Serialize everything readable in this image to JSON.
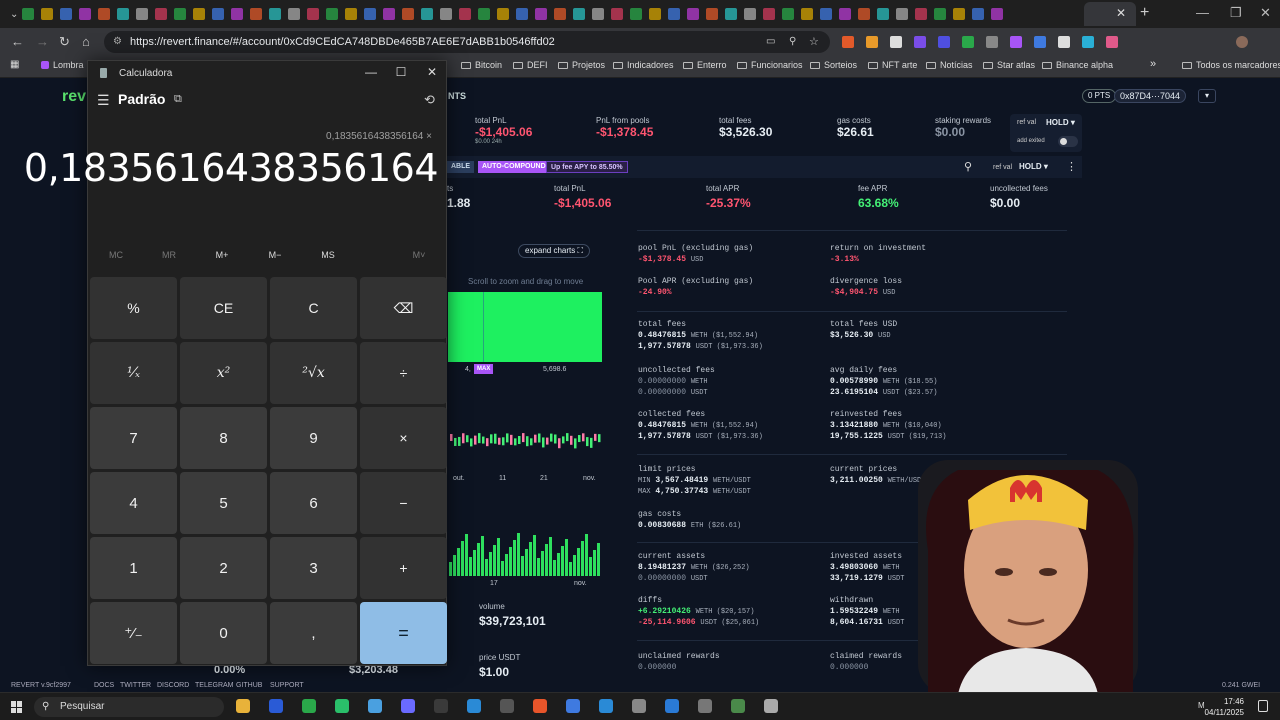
{
  "browser": {
    "url": "https://revert.finance/#/account/0xCd9CEdCA748DBDe465B7AE6E7dABB1b0546ffd02",
    "bookmarks": [
      "Lombra",
      "Bitcoin",
      "DEFI",
      "Projetos",
      "Indicadores",
      "Enterro",
      "Funcionarios",
      "Sorteios",
      "NFT arte",
      "Notícias",
      "Star atlas",
      "Binance alpha"
    ],
    "bookmarks_more": "»",
    "all_bookmarks": "Todos os marcadores"
  },
  "revert": {
    "logo": "rev",
    "nav_item": "NTS",
    "points_badge": "0 PTS",
    "wallet": "0x87D4···7044",
    "summary": {
      "total_pnl_label": "total PnL",
      "total_pnl_value": "-$1,405.06",
      "total_pnl_sub": "$0.00 24h",
      "pnl_pools_label": "PnL from pools",
      "pnl_pools_value": "-$1,378.45",
      "total_fees_label": "total fees",
      "total_fees_value": "$3,526.30",
      "gas_label": "gas costs",
      "gas_value": "$26.61",
      "staking_label": "staking rewards",
      "staking_value": "$0.00",
      "ref_val_label": "ref val",
      "ref_val_value": "HOLD",
      "add_exited_label": "add exited"
    },
    "position_header": {
      "badge_left": "ABLE",
      "badge_autocompound": "AUTO-COMPOUND",
      "badge_fee_apy": "Up fee APY to 85.50%",
      "ref_val_label": "ref val",
      "ref_val_value": "HOLD"
    },
    "position_stats": {
      "left_label": "ts",
      "left_value": "1.88",
      "total_pnl_label": "total PnL",
      "total_pnl_value": "-$1,405.06",
      "total_apr_label": "total APR",
      "total_apr_value": "-25.37%",
      "fee_apr_label": "fee APR",
      "fee_apr_value": "63.68%",
      "uncollected_label": "uncollected fees",
      "uncollected_value": "$0.00"
    },
    "charts": {
      "expand": "expand charts",
      "hint": "Scroll to zoom and drag to move",
      "range_left": "4,",
      "range_tag": "MAX",
      "range_right": "5,698.6",
      "axis_labels": [
        "out.",
        "11",
        "21",
        "nov."
      ],
      "axis2_labels": [
        "17",
        "nov."
      ]
    },
    "details": {
      "pool_pnl_label": "pool PnL (excluding gas)",
      "pool_pnl_value": "-$1,378.45",
      "pool_pnl_unit": "USD",
      "roi_label": "return on investment",
      "roi_value": "-3.13%",
      "pool_apr_label": "Pool APR (excluding gas)",
      "pool_apr_value": "-24.90%",
      "divergence_label": "divergence loss",
      "divergence_value": "-$4,904.75",
      "divergence_unit": "USD",
      "total_fees_label": "total fees",
      "total_fees_l1": "0.48476815",
      "total_fees_l1_unit": "WETH ($1,552.94)",
      "total_fees_l2": "1,977.57878",
      "total_fees_l2_unit": "USDT ($1,973.36)",
      "total_fees_usd_label": "total fees USD",
      "total_fees_usd_value": "$3,526.30",
      "total_fees_usd_unit": "USD",
      "uncollected_label": "uncollected fees",
      "uncollected_l1": "0.00000000",
      "uncollected_l1_unit": "WETH",
      "uncollected_l2": "0.00000000",
      "uncollected_l2_unit": "USDT",
      "avg_daily_label": "avg daily fees",
      "avg_daily_l1": "0.00578990",
      "avg_daily_l1_unit": "WETH ($18.55)",
      "avg_daily_l2": "23.6195104",
      "avg_daily_l2_unit": "USDT ($23.57)",
      "collected_label": "collected fees",
      "collected_l1": "0.48476815",
      "collected_l1_unit": "WETH ($1,552.94)",
      "collected_l2": "1,977.57878",
      "collected_l2_unit": "USDT ($1,973.36)",
      "reinvested_label": "reinvested fees",
      "reinvested_l1": "3.13421880",
      "reinvested_l1_unit": "WETH ($10,040)",
      "reinvested_l2": "19,755.1225",
      "reinvested_l2_unit": "USDT ($19,713)",
      "limit_label": "limit prices",
      "limit_min_prefix": "MIN",
      "limit_min": "3,567.48419",
      "limit_min_unit": "WETH/USDT",
      "limit_max_prefix": "MAX",
      "limit_max": "4,750.37743",
      "limit_max_unit": "WETH/USDT",
      "current_price_label": "current prices",
      "current_price": "3,211.00250",
      "current_price_unit": "WETH/USDT",
      "gas_label": "gas costs",
      "gas_value": "0.00830688",
      "gas_unit": "ETH ($26.61)",
      "current_assets_label": "current assets",
      "current_assets_l1": "8.19481237",
      "current_assets_l1_unit": "WETH ($26,252)",
      "current_assets_l2": "0.00000000",
      "current_assets_l2_unit": "USDT",
      "invested_label": "invested assets",
      "invested_l1": "3.49803060",
      "invested_l1_unit": "WETH",
      "invested_l2": "33,719.1279",
      "invested_l2_unit": "USDT",
      "diffs_label": "diffs",
      "diffs_l1": "+6.29210426",
      "diffs_l1_unit": "WETH ($20,157)",
      "diffs_l2": "-25,114.9606",
      "diffs_l2_unit": "USDT ($25,061)",
      "withdrawn_label": "withdrawn",
      "withdrawn_l1": "1.59532249",
      "withdrawn_l1_unit": "WETH",
      "withdrawn_l2": "8,604.16731",
      "withdrawn_l2_unit": "USDT",
      "unclaimed_label": "unclaimed rewards",
      "unclaimed_value": "0.000000",
      "claimed_label": "claimed rewards",
      "claimed_value": "0.000000"
    },
    "lower_left": {
      "volume_label": "volume",
      "volume_value": "$39,723,101",
      "price_label": "price USDT",
      "price_value": "$1.00",
      "bottom_pct": "0.00%",
      "bottom_price": "$3,203.48"
    },
    "footer": [
      "REVERT v.9cf2997",
      "DOCS",
      "TWITTER",
      "DISCORD",
      "TELEGRAM",
      "GITHUB",
      "SUPPORT"
    ],
    "gwei": "0.241 GWEI"
  },
  "calculator": {
    "window_title": "Calculadora",
    "mode": "Padrão",
    "expression": "0,1835616438356164 ×",
    "display": "0,1835616438356164",
    "memory": [
      "MC",
      "MR",
      "M+",
      "M−",
      "MS",
      "M˅"
    ],
    "keys": [
      "%",
      "CE",
      "C",
      "⌫",
      "¹⁄ₓ",
      "x²",
      "²√x",
      "÷",
      "7",
      "8",
      "9",
      "×",
      "4",
      "5",
      "6",
      "−",
      "1",
      "2",
      "3",
      "+",
      "⁺⁄₋",
      "0",
      ",",
      "="
    ]
  },
  "taskbar": {
    "search_placeholder": "Pesquisar",
    "time": "17:46",
    "date": "04/11/2025"
  },
  "colors": {
    "positive": "#44f076",
    "negative": "#ff5570",
    "accent_purple": "#a855f7",
    "calc_equals": "#8fbde6"
  }
}
